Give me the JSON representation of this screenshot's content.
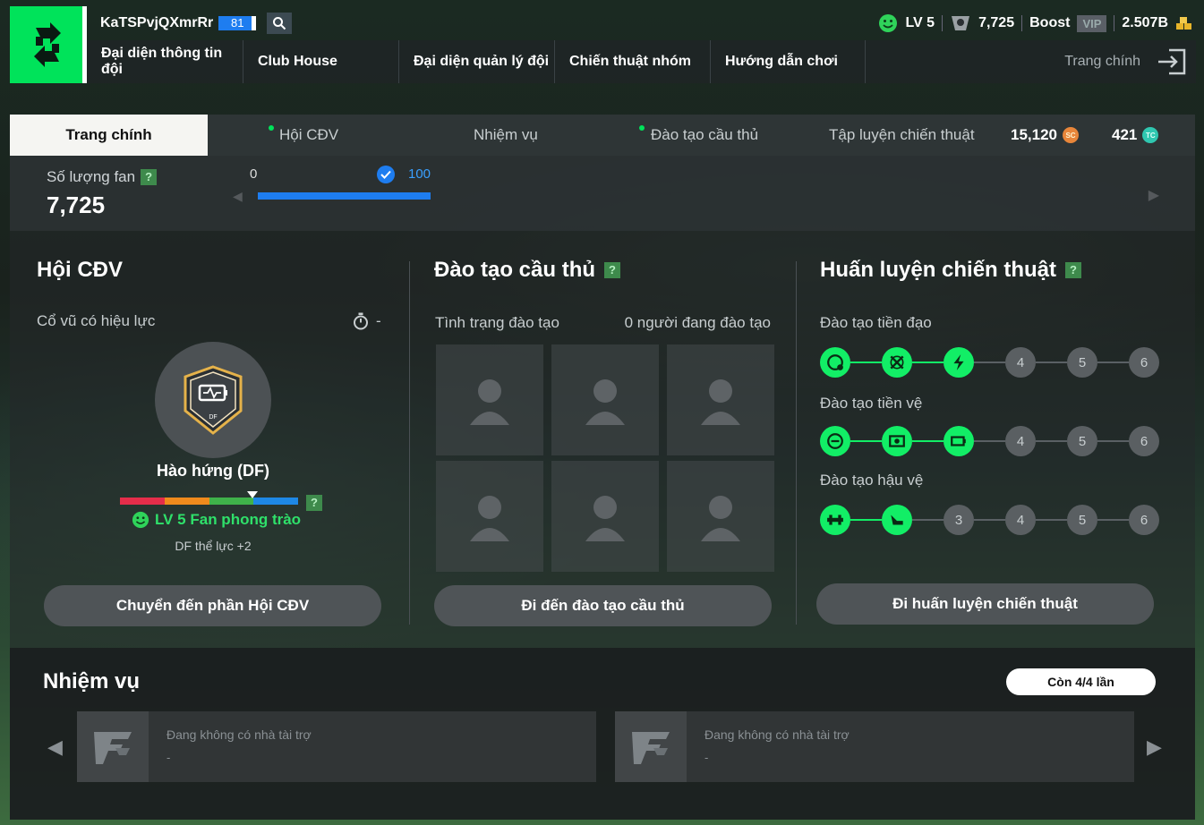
{
  "header": {
    "username": "KaTSPvjQXmrRr",
    "user_level": "81",
    "stats": {
      "level": "LV 5",
      "fans": "7,725",
      "boost_label": "Boost",
      "vip_label": "VIP",
      "balance": "2.507B"
    },
    "nav": [
      "Đại diện thông tin đội",
      "Club House",
      "Đại diện quản lý đội",
      "Chiến thuật nhóm",
      "Hướng dẫn chơi"
    ],
    "home_label": "Trang chính"
  },
  "subtabs": {
    "items": [
      "Trang chính",
      "Hội CĐV",
      "Nhiệm vụ",
      "Đào tạo cầu thủ",
      "Tập luyện chiến thuật"
    ],
    "sc_amount": "15,120",
    "sc_symbol": "SC",
    "tc_amount": "421",
    "tc_symbol": "TC"
  },
  "fan_strip": {
    "label": "Số lượng fan",
    "help": "?",
    "value": "7,725",
    "progress_min": "0",
    "progress_max": "100",
    "progress_fraction": 1.0
  },
  "supporters": {
    "title": "Hội CĐV",
    "effect_label": "Cổ vũ có hiệu lực",
    "effect_time": "-",
    "badge_pos": "DF",
    "badge_name": "Hào hứng (DF)",
    "help": "?",
    "fan_level": "LV 5 Fan phong trào",
    "bonus": "DF thể lực +2",
    "button": "Chuyển đến phần Hội CĐV"
  },
  "training": {
    "title": "Đào tạo cầu thủ",
    "help": "?",
    "status_label": "Tình trạng đào tạo",
    "status_value": "0 người đang đào tạo",
    "button": "Đi đến đào tạo cầu thủ"
  },
  "tactics": {
    "title": "Huấn luyện chiến thuật",
    "help": "?",
    "rows": [
      {
        "label": "Đào tạo tiền đạo",
        "nodes": [
          "",
          "",
          "",
          "4",
          "5",
          "6"
        ],
        "unlocked": 3
      },
      {
        "label": "Đào tạo tiền vệ",
        "nodes": [
          "",
          "",
          "",
          "4",
          "5",
          "6"
        ],
        "unlocked": 3
      },
      {
        "label": "Đào tạo hậu vệ",
        "nodes": [
          "",
          "",
          "3",
          "4",
          "5",
          "6"
        ],
        "unlocked": 2
      }
    ],
    "button": "Đi huấn luyện chiến thuật"
  },
  "missions": {
    "title": "Nhiệm vụ",
    "remaining": "Còn 4/4 lần",
    "cards": [
      {
        "text": "Đang không có nhà tài trợ",
        "sub": "-"
      },
      {
        "text": "Đang không có nhà tài trợ",
        "sub": "-"
      }
    ]
  },
  "colors": {
    "accent_green": "#00e35a",
    "accent_blue": "#1e7df0",
    "node_on": "#12ee66"
  }
}
